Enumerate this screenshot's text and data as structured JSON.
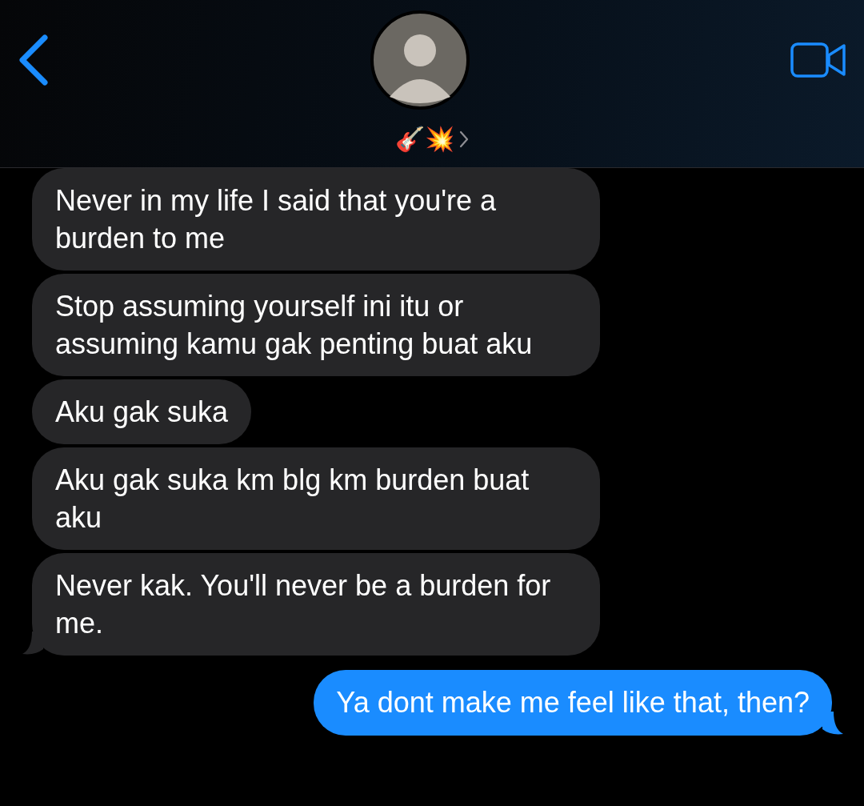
{
  "header": {
    "contact_name": "🎸💥"
  },
  "messages": [
    {
      "kind": "received",
      "text": "Never in my life I said that you're a burden to me",
      "tail": false
    },
    {
      "kind": "received",
      "text": "Stop assuming yourself ini itu or assuming kamu gak penting buat aku",
      "tail": false
    },
    {
      "kind": "received",
      "text": "Aku gak suka",
      "tail": false
    },
    {
      "kind": "received",
      "text": "Aku gak suka km blg km burden buat aku",
      "tail": false
    },
    {
      "kind": "received",
      "text": "Never kak. You'll never be a burden for me.",
      "tail": true
    },
    {
      "kind": "sent",
      "text": "Ya dont make me feel like that, then?",
      "tail": true
    }
  ]
}
